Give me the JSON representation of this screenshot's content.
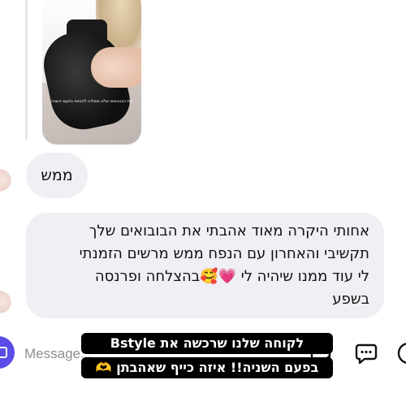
{
  "story_reply": {
    "caption_text": "את הבובואים שלנו משלוח לחנויות בפעם השניה"
  },
  "messages": [
    {
      "text_lines": [
        "ממש"
      ]
    },
    {
      "text_lines": [
        "אחותי היקרה מאוד אהבתי את הבובואים שלך",
        "תקשיבי והאחרון עם הנפח ממש מרשים הזמנתי",
        "לי עוד ממנו שיהיה לי 💗🥰בהצלחה ופרנסה",
        "בשפע"
      ]
    }
  ],
  "composer": {
    "placeholder": "Message...",
    "icons": [
      "camera-icon",
      "sticker-icon",
      "chat-bubble-icon",
      "add-icon"
    ]
  },
  "overlay_caption": {
    "line1": "לקוחה שלנו שרכשה את Bstyle",
    "line2": "בפעם השניה!! איזה כייף שאהבתן 🫶"
  },
  "colors": {
    "bubble_bg": "#efeff4",
    "camera_button": "#5b4be8",
    "overlay_bg": "#000000"
  }
}
